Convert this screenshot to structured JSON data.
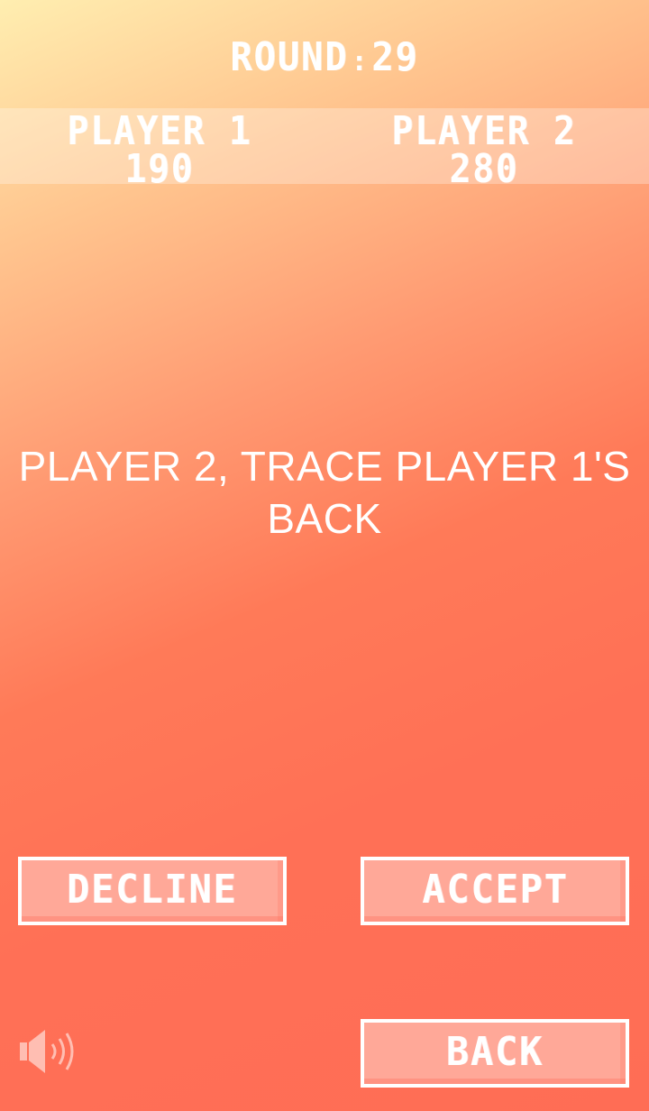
{
  "header": {
    "round_label": "ROUND",
    "separator": ":",
    "round_number": "29"
  },
  "players": [
    {
      "name": "PLAYER 1",
      "score": "190"
    },
    {
      "name": "PLAYER 2",
      "score": "280"
    }
  ],
  "instruction": "PLAYER 2, TRACE PLAYER 1'S BACK",
  "buttons": {
    "decline": "DECLINE",
    "accept": "ACCEPT",
    "back": "BACK"
  },
  "icons": {
    "sound": "speaker-icon"
  },
  "colors": {
    "background_top": "#ffeeb0",
    "background_bottom": "#ff6d55",
    "button_fill": "#ffa898",
    "text": "#ffffff"
  }
}
